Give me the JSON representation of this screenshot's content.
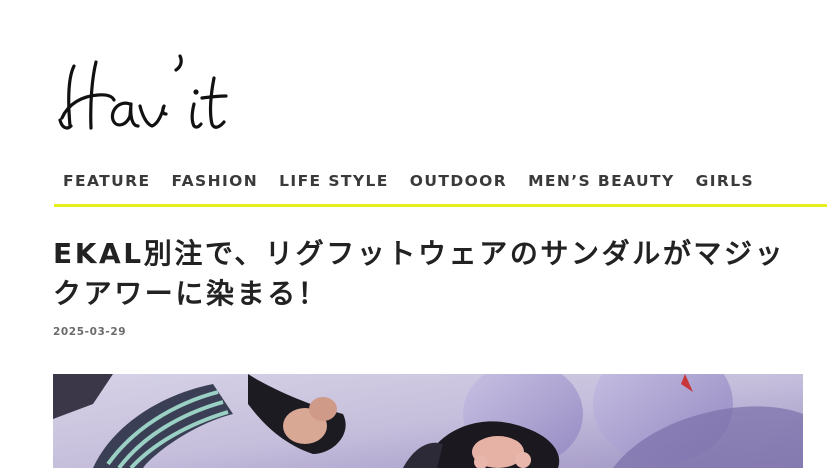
{
  "site": {
    "logo_text": "Hav'it"
  },
  "nav": {
    "items": [
      {
        "label": "FEATURE"
      },
      {
        "label": "FASHION"
      },
      {
        "label": "LIFE STYLE"
      },
      {
        "label": "OUTDOOR"
      },
      {
        "label": "MEN’S BEAUTY"
      },
      {
        "label": "GIRLS"
      }
    ]
  },
  "colors": {
    "accent": "#e8ef1a",
    "text": "#222222",
    "muted": "#6b6b6b"
  },
  "article": {
    "title": "EKAL別注で、リグフットウェアのサンダルがマジックアワーに染まる！",
    "date": "2025-03-29",
    "hero_image": "sandals-photo"
  }
}
